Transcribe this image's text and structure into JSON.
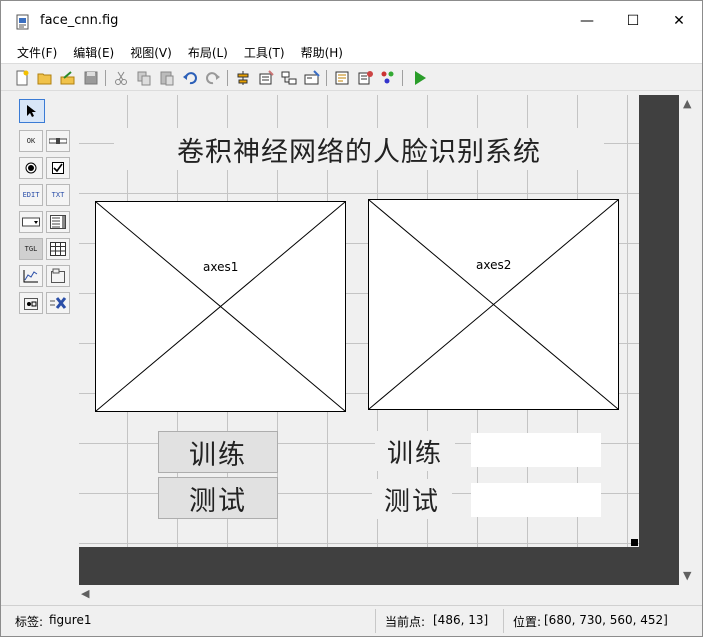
{
  "window": {
    "title": "face_cnn.fig",
    "minimize": "—",
    "maximize": "☐",
    "close": "✕"
  },
  "menu": [
    "文件(F)",
    "编辑(E)",
    "视图(V)",
    "布局(L)",
    "工具(T)",
    "帮助(H)"
  ],
  "toolbar_icons": [
    "new-icon",
    "open-icon",
    "export-icon",
    "save-icon",
    "cut-icon",
    "copy-icon",
    "paste-icon",
    "undo-icon",
    "redo-icon",
    "align-icon",
    "menu-editor-icon",
    "tab-order-icon",
    "toolbar-editor-icon",
    "editor-icon",
    "property-inspector-icon",
    "object-browser-icon",
    "run-icon"
  ],
  "palette": {
    "items": [
      "select",
      "OK",
      "slider",
      "radio",
      "checkbox",
      "EDIT",
      "TXT",
      "popup",
      "listbox",
      "TGL",
      "table",
      "axes",
      "panel",
      "buttongroup",
      "activex"
    ],
    "labels": {
      "ok": "OK",
      "edit": "EDIT",
      "txt": "TXT",
      "tgl": "TGL"
    }
  },
  "figure": {
    "title": "卷积神经网络的人脸识别系统",
    "axes1_label": "axes1",
    "axes2_label": "axes2",
    "train_button": "训练",
    "test_button": "测试",
    "train_text": "训练",
    "test_text": "测试",
    "train_value": "",
    "test_value": ""
  },
  "status": {
    "tag_label": "标签:",
    "tag_value": "figure1",
    "current_point_label": "当前点:",
    "current_point_value": "[486, 13]",
    "position_label": "位置:",
    "position_value": "[680, 730, 560, 452]"
  },
  "colors": {
    "grid": "#c4c4c4",
    "canvas": "#f0f0f0",
    "outside": "#404040",
    "run": "#2a9d2a"
  }
}
